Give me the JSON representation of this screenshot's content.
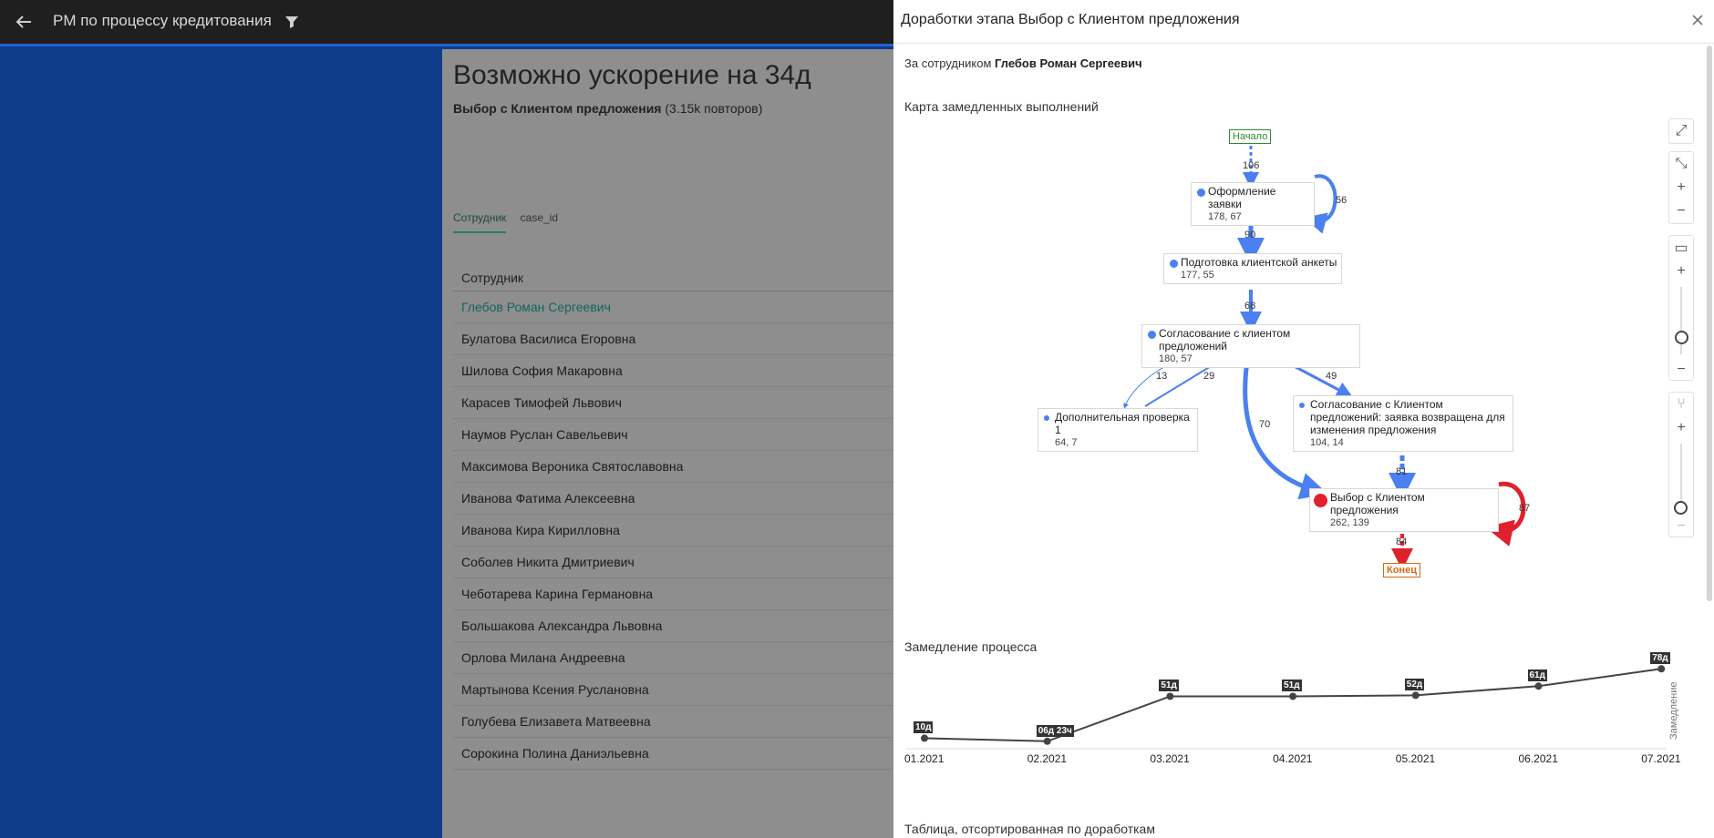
{
  "topbar": {
    "title": "PM по процессу кредитования"
  },
  "left": {
    "heading": "Возможно ускорение на 34д",
    "subtitle_bold": "Выбор с Клиентом предложения",
    "subtitle_rest": " (3.15k повторов)",
    "tabs": [
      {
        "label": "Сотрудник"
      },
      {
        "label": "case_id"
      }
    ],
    "table_header": "Сотрудник",
    "rows": [
      "Глебов Роман Сергеевич",
      "Булатова Василиса Егоровна",
      "Шилова София Макаровна",
      "Карасев Тимофей Львович",
      "Наумов Руслан Савельевич",
      "Максимова Вероника Святославовна",
      "Иванова Фатима Алексеевна",
      "Иванова Кира Кирилловна",
      "Соболев Никита Дмитриевич",
      "Чеботарева Карина Германовна",
      "Большакова Александра Львовна",
      "Орлова Милана Андреевна",
      "Мартынова Ксения Руслановна",
      "Голубева Елизавета Матвеевна",
      "Сорокина Полина Даниэльевна"
    ]
  },
  "modal": {
    "title": "Доработки этапа Выбор с Клиентом предложения",
    "by_employee_prefix": "За сотрудником ",
    "by_employee_name": "Глебов Роман Сергеевич",
    "map_title": "Карта замедленных выполнений",
    "slowdown_title": "Замедление процесса",
    "table_title": "Таблица, отсортированная по доработкам"
  },
  "diagram": {
    "start": "Начало",
    "end": "Конец",
    "nodes": {
      "n1": {
        "label": "Оформление заявки",
        "stat": "178, 67"
      },
      "n2": {
        "label": "Подготовка клиентской анкеты",
        "stat": "177, 55"
      },
      "n3": {
        "label": "Согласование с клиентом предложений",
        "stat": "180, 57"
      },
      "n4": {
        "label": "Дополнительная проверка 1",
        "stat": "64, 7"
      },
      "n5": {
        "label": "Согласование с Клиентом предложений: заявка возвращена для изменения предложения",
        "stat": "104, 14"
      },
      "n6": {
        "label": "Выбор с Клиентом предложения",
        "stat": "262, 139"
      }
    },
    "edges": {
      "e_start_n1": "106",
      "e_n1_loop": "56",
      "e_n1_n2": "90",
      "e_n2_n3": "68",
      "e_n3_n4": "13",
      "e_n4_n3": "29",
      "e_n3_n5": "49",
      "e_n3_n6": "70",
      "e_n5_n6": "81",
      "e_n6_loop": "87",
      "e_n6_end": "84"
    },
    "colors": {
      "normal": "#4a80f0",
      "critical": "#e0202c"
    }
  },
  "chart_data": {
    "type": "line",
    "categories": [
      "01.2021",
      "02.2021",
      "03.2021",
      "04.2021",
      "05.2021",
      "06.2021",
      "07.2021"
    ],
    "values_days": [
      10,
      6.96,
      51,
      51,
      52,
      61,
      78
    ],
    "data_labels": [
      "10д",
      "06д 23ч",
      "51д",
      "51д",
      "52д",
      "61д",
      "78д"
    ],
    "ylabel": "Замедление",
    "xlabel": ""
  }
}
